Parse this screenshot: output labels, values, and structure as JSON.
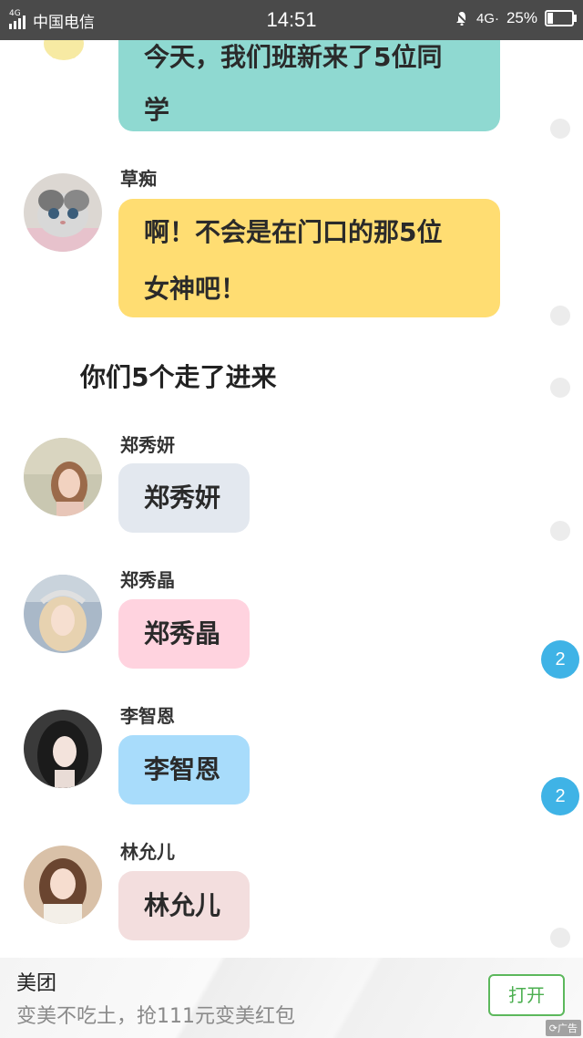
{
  "status_bar": {
    "network_small": "4G",
    "carrier": "中国电信",
    "time": "14:51",
    "network": "4G·",
    "battery": "25%"
  },
  "messages": [
    {
      "lines": [
        "今天，我们班新来了5位同",
        "学"
      ],
      "color": "#8fd9d1"
    },
    {
      "sender": "草痴",
      "lines": [
        "啊！不会是在门口的那5位",
        "女神吧！"
      ],
      "color": "#ffdd72"
    },
    {
      "narration": "你们5个走了进来"
    },
    {
      "sender": "郑秀妍",
      "text": "郑秀妍",
      "color": "#e3e8ef"
    },
    {
      "sender": "郑秀晶",
      "text": "郑秀晶",
      "color": "#ffd3df"
    },
    {
      "sender": "李智恩",
      "text": "李智恩",
      "color": "#a8dcfb"
    },
    {
      "sender": "林允儿",
      "text": "林允儿",
      "color": "#f3dede"
    }
  ],
  "badges": [
    "2",
    "2"
  ],
  "ad": {
    "title": "美团",
    "text": "变美不吃土，抢111元变美红包",
    "button": "打开",
    "tag": "广告"
  }
}
